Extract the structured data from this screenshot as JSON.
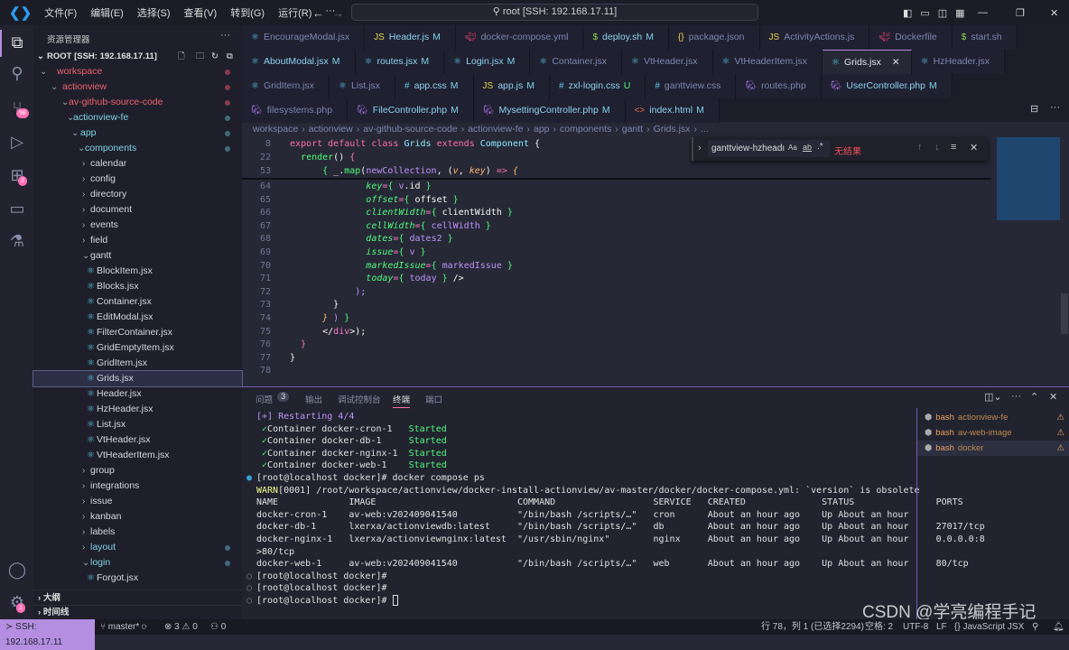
{
  "titlebar": {
    "menus": [
      "文件(F)",
      "编辑(E)",
      "选择(S)",
      "查看(V)",
      "转到(G)",
      "运行(R)",
      "···"
    ],
    "search": "root [SSH: 192.168.17.11]"
  },
  "activity": {
    "scm_badge": "98",
    "ext_badge": "2",
    "settings_badge": "1"
  },
  "sidebar": {
    "title": "资源管理器",
    "more": "···",
    "root": "ROOT [SSH: 192.168.17.11]",
    "items": [
      {
        "label": "workspace",
        "level": 0,
        "type": "open",
        "color": "red"
      },
      {
        "label": "actionview",
        "level": 1,
        "type": "open",
        "color": "red"
      },
      {
        "label": "av-github-source-code",
        "level": 2,
        "type": "open",
        "color": "red"
      },
      {
        "label": "actionview-fe",
        "level": 3,
        "type": "open",
        "color": "cyan"
      },
      {
        "label": "app",
        "level": 4,
        "type": "open",
        "color": "cyan"
      },
      {
        "label": "components",
        "level": 5,
        "type": "open",
        "color": "cyan"
      },
      {
        "label": "calendar",
        "level": 6,
        "type": "closed"
      },
      {
        "label": "config",
        "level": 6,
        "type": "closed"
      },
      {
        "label": "directory",
        "level": 6,
        "type": "closed"
      },
      {
        "label": "document",
        "level": 6,
        "type": "closed"
      },
      {
        "label": "events",
        "level": 6,
        "type": "closed"
      },
      {
        "label": "field",
        "level": 6,
        "type": "closed"
      },
      {
        "label": "gantt",
        "level": 6,
        "type": "open"
      },
      {
        "label": "BlockItem.jsx",
        "level": 7,
        "type": "file"
      },
      {
        "label": "Blocks.jsx",
        "level": 7,
        "type": "file"
      },
      {
        "label": "Container.jsx",
        "level": 7,
        "type": "file"
      },
      {
        "label": "EditModal.jsx",
        "level": 7,
        "type": "file"
      },
      {
        "label": "FilterContainer.jsx",
        "level": 7,
        "type": "file"
      },
      {
        "label": "GridEmptyItem.jsx",
        "level": 7,
        "type": "file"
      },
      {
        "label": "GridItem.jsx",
        "level": 7,
        "type": "file"
      },
      {
        "label": "Grids.jsx",
        "level": 7,
        "type": "file",
        "selected": true
      },
      {
        "label": "Header.jsx",
        "level": 7,
        "type": "file"
      },
      {
        "label": "HzHeader.jsx",
        "level": 7,
        "type": "file"
      },
      {
        "label": "List.jsx",
        "level": 7,
        "type": "file"
      },
      {
        "label": "VtHeader.jsx",
        "level": 7,
        "type": "file"
      },
      {
        "label": "VtHeaderItem.jsx",
        "level": 7,
        "type": "file"
      },
      {
        "label": "group",
        "level": 6,
        "type": "closed"
      },
      {
        "label": "integrations",
        "level": 6,
        "type": "closed"
      },
      {
        "label": "issue",
        "level": 6,
        "type": "closed"
      },
      {
        "label": "kanban",
        "level": 6,
        "type": "closed"
      },
      {
        "label": "labels",
        "level": 6,
        "type": "closed"
      },
      {
        "label": "layout",
        "level": 6,
        "type": "closed",
        "color": "cyan"
      },
      {
        "label": "login",
        "level": 6,
        "type": "open",
        "color": "cyan"
      },
      {
        "label": "Forgot.jsx",
        "level": 7,
        "type": "file"
      }
    ],
    "outline": "大纲",
    "timeline": "时间线"
  },
  "tabs": [
    [
      {
        "label": "EncourageModal.jsx",
        "icon": "react"
      },
      {
        "label": "Header.js",
        "icon": "js",
        "badge": "M"
      },
      {
        "label": "docker-compose.yml",
        "icon": "docker"
      },
      {
        "label": "deploy.sh",
        "icon": "shell",
        "badge": "M"
      },
      {
        "label": "package.json",
        "icon": "json"
      },
      {
        "label": "ActivityActions.js",
        "icon": "js"
      },
      {
        "label": "Dockerfile",
        "icon": "docker"
      },
      {
        "label": "start.sh",
        "icon": "shell"
      }
    ],
    [
      {
        "label": "AboutModal.jsx",
        "icon": "react",
        "badge": "M"
      },
      {
        "label": "routes.jsx",
        "icon": "react",
        "badge": "M"
      },
      {
        "label": "Login.jsx",
        "icon": "react",
        "badge": "M"
      },
      {
        "label": "Container.jsx",
        "icon": "react"
      },
      {
        "label": "VtHeader.jsx",
        "icon": "react"
      },
      {
        "label": "VtHeaderItem.jsx",
        "icon": "react"
      },
      {
        "label": "Grids.jsx",
        "icon": "react",
        "active": true
      },
      {
        "label": "HzHeader.jsx",
        "icon": "react"
      }
    ],
    [
      {
        "label": "GridItem.jsx",
        "icon": "react"
      },
      {
        "label": "List.jsx",
        "icon": "react"
      },
      {
        "label": "app.css",
        "icon": "css",
        "badge": "M"
      },
      {
        "label": "app.js",
        "icon": "js",
        "badge": "M"
      },
      {
        "label": "zxl-login.css",
        "icon": "css",
        "badge": "U"
      },
      {
        "label": "ganttview.css",
        "icon": "css"
      },
      {
        "label": "routes.php",
        "icon": "php"
      },
      {
        "label": "UserController.php",
        "icon": "php",
        "badge": "M"
      }
    ],
    [
      {
        "label": "filesystems.php",
        "icon": "php"
      },
      {
        "label": "FileController.php",
        "icon": "php",
        "badge": "M"
      },
      {
        "label": "MysettingController.php",
        "icon": "php",
        "badge": "M"
      },
      {
        "label": "index.html",
        "icon": "html",
        "badge": "M"
      }
    ]
  ],
  "breadcrumb": [
    "workspace",
    "actionview",
    "av-github-source-code",
    "actionview-fe",
    "app",
    "components",
    "gantt",
    "Grids.jsx",
    "..."
  ],
  "find": {
    "value": "ganttview-hzheadı",
    "case": "Aa",
    "word": "ab",
    "regex": ".*",
    "result": "无结果"
  },
  "code": {
    "sticky": [
      {
        "n": "8",
        "t": [
          [
            "export ",
            "kw"
          ],
          [
            "default ",
            "kw"
          ],
          [
            "class ",
            "kw"
          ],
          [
            "Grids ",
            "cls"
          ],
          [
            "extends ",
            "kw"
          ],
          [
            "Component ",
            "cls"
          ],
          [
            "{",
            "pu"
          ]
        ]
      },
      {
        "n": "22",
        "t": [
          [
            "  ",
            ""
          ],
          [
            "render",
            "fn"
          ],
          [
            "() ",
            "pu"
          ],
          [
            "{",
            "br"
          ]
        ]
      },
      {
        "n": "53",
        "t": [
          [
            "      ",
            ""
          ],
          [
            "{ ",
            "bg"
          ],
          [
            "_.",
            "tx"
          ],
          [
            "map",
            "fn"
          ],
          [
            "(",
            "pu"
          ],
          [
            "newCollection",
            "va"
          ],
          [
            ", (",
            "pu"
          ],
          [
            "v",
            "pr"
          ],
          [
            ", ",
            "pu"
          ],
          [
            "key",
            "pr"
          ],
          [
            ") ",
            "pu"
          ],
          [
            "=> ",
            "kw"
          ],
          [
            "{",
            "pr"
          ]
        ]
      }
    ],
    "lines": [
      {
        "n": "64",
        "t": [
          [
            "              ",
            ""
          ],
          [
            "key",
            "at"
          ],
          [
            "=",
            "br"
          ],
          [
            "{ ",
            "bg"
          ],
          [
            "v",
            "va"
          ],
          [
            ".id ",
            "tx"
          ],
          [
            "}",
            "bg"
          ]
        ]
      },
      {
        "n": "65",
        "t": [
          [
            "              ",
            ""
          ],
          [
            "offset",
            "at"
          ],
          [
            "=",
            "br"
          ],
          [
            "{ ",
            "bg"
          ],
          [
            "offset ",
            "tx"
          ],
          [
            "}",
            "bg"
          ]
        ]
      },
      {
        "n": "66",
        "t": [
          [
            "              ",
            ""
          ],
          [
            "clientWidth",
            "at"
          ],
          [
            "=",
            "br"
          ],
          [
            "{ ",
            "bg"
          ],
          [
            "clientWidth ",
            "tx"
          ],
          [
            "}",
            "bg"
          ]
        ]
      },
      {
        "n": "67",
        "t": [
          [
            "              ",
            ""
          ],
          [
            "cellWidth",
            "at"
          ],
          [
            "=",
            "br"
          ],
          [
            "{ ",
            "bg"
          ],
          [
            "cellWidth ",
            "va"
          ],
          [
            "}",
            "bg"
          ]
        ]
      },
      {
        "n": "68",
        "t": [
          [
            "              ",
            ""
          ],
          [
            "dates",
            "at"
          ],
          [
            "=",
            "br"
          ],
          [
            "{ ",
            "bg"
          ],
          [
            "dates2 ",
            "va"
          ],
          [
            "}",
            "bg"
          ]
        ]
      },
      {
        "n": "69",
        "t": [
          [
            "              ",
            ""
          ],
          [
            "issue",
            "at"
          ],
          [
            "=",
            "br"
          ],
          [
            "{ ",
            "bg"
          ],
          [
            "v ",
            "va"
          ],
          [
            "}",
            "bg"
          ]
        ]
      },
      {
        "n": "70",
        "t": [
          [
            "              ",
            ""
          ],
          [
            "markedIssue",
            "at"
          ],
          [
            "=",
            "br"
          ],
          [
            "{ ",
            "bg"
          ],
          [
            "markedIssue ",
            "va"
          ],
          [
            "}",
            "bg"
          ]
        ]
      },
      {
        "n": "71",
        "t": [
          [
            "              ",
            ""
          ],
          [
            "today",
            "at"
          ],
          [
            "=",
            "br"
          ],
          [
            "{ ",
            "bg"
          ],
          [
            "today ",
            "va"
          ],
          [
            "} ",
            "bg"
          ],
          [
            "/>",
            "tx"
          ]
        ]
      },
      {
        "n": "72",
        "t": [
          [
            "            ",
            ""
          ],
          [
            ");",
            "va"
          ]
        ]
      },
      {
        "n": "73",
        "t": [
          [
            "        ",
            ""
          ],
          [
            "}",
            "tx"
          ]
        ]
      },
      {
        "n": "74",
        "t": [
          [
            "      ",
            ""
          ],
          [
            "} ",
            "pr"
          ],
          [
            ") ",
            "va"
          ],
          [
            "}",
            "bg"
          ]
        ]
      },
      {
        "n": "75",
        "t": [
          [
            "      ",
            ""
          ],
          [
            "</",
            "tx"
          ],
          [
            "div",
            "br"
          ],
          [
            ">);",
            "tx"
          ]
        ]
      },
      {
        "n": "76",
        "t": [
          [
            "  ",
            ""
          ],
          [
            "}",
            "br"
          ]
        ]
      },
      {
        "n": "77",
        "t": [
          [
            "}",
            "tx"
          ]
        ]
      },
      {
        "n": "78",
        "t": []
      }
    ]
  },
  "panel": {
    "tabs": [
      "问题",
      "输出",
      "调试控制台",
      "终端",
      "端口"
    ],
    "problems_count": "3",
    "active_tab": "终端"
  },
  "terminal": {
    "lines": [
      [
        [
          "[+] Restarting 4/4",
          "#bd93f9"
        ]
      ],
      [
        [
          " ✓",
          "#50fa7b"
        ],
        [
          "Container docker-cron-1   ",
          ""
        ],
        [
          "Started",
          "#50fa7b"
        ]
      ],
      [
        [
          " ✓",
          "#50fa7b"
        ],
        [
          "Container docker-db-1     ",
          ""
        ],
        [
          "Started",
          "#50fa7b"
        ]
      ],
      [
        [
          " ✓",
          "#50fa7b"
        ],
        [
          "Container docker-nginx-1  ",
          ""
        ],
        [
          "Started",
          "#50fa7b"
        ]
      ],
      [
        [
          " ✓",
          "#50fa7b"
        ],
        [
          "Container docker-web-1    ",
          ""
        ],
        [
          "Started",
          "#50fa7b"
        ]
      ],
      [
        [
          "[root@localhost docker]# docker compose ps",
          ""
        ]
      ],
      [
        [
          "WARN",
          "#f1fa8c"
        ],
        [
          "[0001] /root/workspace/actionview/docker-install-actionview/av-master/docker/docker-compose.yml: `version` is obsolete",
          ""
        ]
      ],
      [
        [
          "NAME             IMAGE                          COMMAND                  SERVICE   CREATED              STATUS               PORTS",
          ""
        ]
      ],
      [
        [
          "docker-cron-1    av-web:v202409041540           \"/bin/bash /scripts/…\"   cron      About an hour ago    Up About an hour",
          ""
        ]
      ],
      [
        [
          "docker-db-1      lxerxa/actionviewdb:latest     \"/bin/bash /scripts/…\"   db        About an hour ago    Up About an hour     27017/tcp",
          ""
        ]
      ],
      [
        [
          "docker-nginx-1   lxerxa/actionviewnginx:latest  \"/usr/sbin/nginx\"        nginx     About an hour ago    Up About an hour     0.0.0.0:8",
          ""
        ]
      ],
      [
        [
          ">80/tcp",
          ""
        ]
      ],
      [
        [
          "docker-web-1     av-web:v202409041540           \"/bin/bash /scripts/…\"   web       About an hour ago    Up About an hour     80/tcp",
          ""
        ]
      ],
      [
        [
          "[root@localhost docker]#",
          ""
        ]
      ],
      [
        [
          "[root@localhost docker]#",
          ""
        ]
      ],
      [
        [
          "[root@localhost docker]# ",
          ""
        ]
      ]
    ],
    "sessions": [
      {
        "shell": "bash",
        "name": "actionview-fe"
      },
      {
        "shell": "bash",
        "name": "av-web-image"
      },
      {
        "shell": "bash",
        "name": "docker",
        "active": true
      }
    ]
  },
  "status": {
    "remote": "SSH: 192.168.17.11",
    "branch": "master*",
    "errors": "3",
    "warnings": "0",
    "ports": "0",
    "position": "行 78，列 1 (已选择2294)",
    "spaces": "空格: 2",
    "encoding": "UTF-8",
    "eol": "LF",
    "language": "JavaScript JSX"
  },
  "watermark": "CSDN @学亮编程手记",
  "colors": {
    "accent": "#b48ee0",
    "modified": "#7fd3e6",
    "deleted": "#f0616e",
    "status_bg": "#181922"
  }
}
